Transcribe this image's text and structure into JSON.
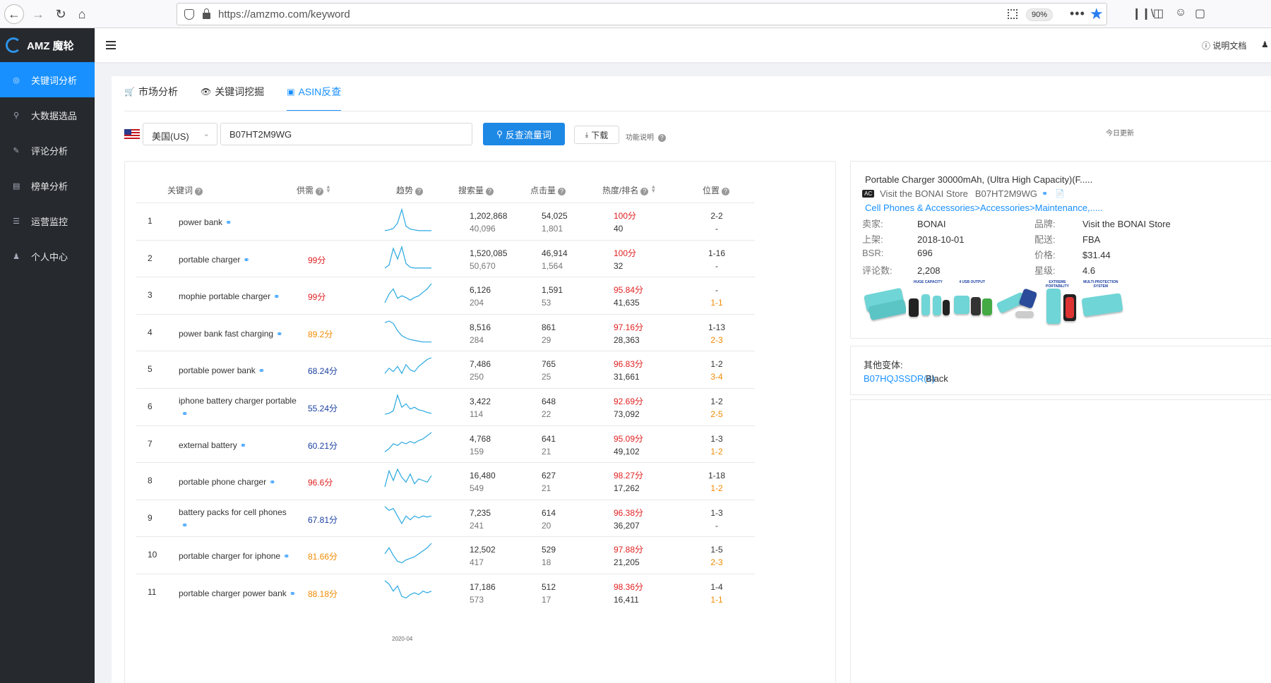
{
  "browser": {
    "url": "https://amzmo.com/keyword",
    "zoom": "90%"
  },
  "app": {
    "title": "AMZ 魔轮"
  },
  "sidebar": {
    "items": [
      {
        "label": "关键词分析",
        "active": true,
        "icon": "target-icon"
      },
      {
        "label": "大数据选品",
        "active": false,
        "icon": "search-icon"
      },
      {
        "label": "评论分析",
        "active": false,
        "icon": "edit-icon"
      },
      {
        "label": "榜单分析",
        "active": false,
        "icon": "list-icon"
      },
      {
        "label": "运营监控",
        "active": false,
        "icon": "menu-icon"
      },
      {
        "label": "个人中心",
        "active": false,
        "icon": "user-icon"
      }
    ]
  },
  "header": {
    "doc": "说明文档"
  },
  "tabs": [
    {
      "label": "市场分析",
      "icon": "cart-icon",
      "active": false
    },
    {
      "label": "关键词挖掘",
      "icon": "eye-icon",
      "active": false
    },
    {
      "label": "ASIN反查",
      "icon": "camera-icon",
      "active": true
    }
  ],
  "search": {
    "country": "美国(US)",
    "asin": "B07HT2M9WG",
    "submit": "反查流量词",
    "download": "下载",
    "func_note": "功能说明",
    "today_note": "今日更新"
  },
  "table": {
    "headers": {
      "keyword": "关键词",
      "supply": "供需",
      "trend": "趋势",
      "search": "搜索量",
      "click": "点击量",
      "heat": "热度/排名",
      "position": "位置"
    },
    "trend_date": "2020-04",
    "rows": [
      {
        "idx": "1",
        "keyword": "power bank",
        "supply": "",
        "supply_color": "",
        "search": "1,202,868",
        "search_sub": "40,096",
        "click": "54,025",
        "click_sub": "1,801",
        "heat": "100分",
        "rank": "40",
        "pos": "2-2",
        "pos_sub": "-",
        "pos_sub_color": "",
        "trend": [
          2,
          3,
          5,
          12,
          30,
          8,
          4,
          3,
          2,
          2,
          2,
          2
        ]
      },
      {
        "idx": "2",
        "keyword": "portable charger",
        "supply": "99分",
        "supply_color": "red",
        "search": "1,520,085",
        "search_sub": "50,670",
        "click": "46,914",
        "click_sub": "1,564",
        "heat": "100分",
        "rank": "32",
        "pos": "1-16",
        "pos_sub": "-",
        "pos_sub_color": "",
        "trend": [
          2,
          6,
          28,
          14,
          30,
          8,
          3,
          2,
          2,
          2,
          2,
          2
        ]
      },
      {
        "idx": "3",
        "keyword": "mophie portable charger",
        "supply": "99分",
        "supply_color": "red",
        "search": "6,126",
        "search_sub": "204",
        "click": "1,591",
        "click_sub": "53",
        "heat": "95.84分",
        "rank": "41,635",
        "pos": "-",
        "pos_sub": "1-1",
        "pos_sub_color": "orange",
        "trend": [
          4,
          14,
          20,
          9,
          12,
          10,
          7,
          10,
          12,
          16,
          20,
          26
        ]
      },
      {
        "idx": "4",
        "keyword": "power bank fast charging",
        "supply": "89.2分",
        "supply_color": "orange",
        "search": "8,516",
        "search_sub": "284",
        "click": "861",
        "click_sub": "29",
        "heat": "97.16分",
        "rank": "28,363",
        "pos": "1-13",
        "pos_sub": "2-3",
        "pos_sub_color": "orange",
        "trend": [
          26,
          28,
          25,
          16,
          10,
          7,
          5,
          4,
          3,
          2,
          2,
          2
        ]
      },
      {
        "idx": "5",
        "keyword": "portable power bank",
        "supply": "68.24分",
        "supply_color": "blue",
        "search": "7,486",
        "search_sub": "250",
        "click": "765",
        "click_sub": "25",
        "heat": "96.83分",
        "rank": "31,661",
        "pos": "1-2",
        "pos_sub": "3-4",
        "pos_sub_color": "orange",
        "trend": [
          8,
          14,
          10,
          16,
          8,
          18,
          12,
          10,
          16,
          20,
          24,
          26
        ]
      },
      {
        "idx": "6",
        "keyword": "iphone battery charger portable",
        "supply": "55.24分",
        "supply_color": "blue",
        "search": "3,422",
        "search_sub": "114",
        "click": "648",
        "click_sub": "22",
        "heat": "92.69分",
        "rank": "73,092",
        "pos": "1-2",
        "pos_sub": "2-5",
        "pos_sub_color": "orange",
        "trend": [
          4,
          5,
          8,
          26,
          12,
          16,
          10,
          12,
          9,
          8,
          6,
          5
        ]
      },
      {
        "idx": "7",
        "keyword": "external battery",
        "supply": "60.21分",
        "supply_color": "blue",
        "search": "4,768",
        "search_sub": "159",
        "click": "641",
        "click_sub": "21",
        "heat": "95.09分",
        "rank": "49,102",
        "pos": "1-3",
        "pos_sub": "1-2",
        "pos_sub_color": "orange",
        "trend": [
          4,
          8,
          14,
          12,
          16,
          14,
          17,
          15,
          18,
          20,
          24,
          28
        ]
      },
      {
        "idx": "8",
        "keyword": "portable phone charger",
        "supply": "96.6分",
        "supply_color": "red",
        "search": "16,480",
        "search_sub": "549",
        "click": "627",
        "click_sub": "21",
        "heat": "98.27分",
        "rank": "17,262",
        "pos": "1-18",
        "pos_sub": "1-2",
        "pos_sub_color": "orange",
        "trend": [
          6,
          26,
          14,
          28,
          18,
          12,
          22,
          10,
          16,
          14,
          12,
          20
        ]
      },
      {
        "idx": "9",
        "keyword": "battery packs for cell phones",
        "supply": "67.81分",
        "supply_color": "blue",
        "search": "7,235",
        "search_sub": "241",
        "click": "614",
        "click_sub": "20",
        "heat": "96.38分",
        "rank": "36,207",
        "pos": "1-3",
        "pos_sub": "-",
        "pos_sub_color": "",
        "trend": [
          24,
          20,
          22,
          14,
          6,
          14,
          10,
          14,
          12,
          14,
          13,
          14
        ]
      },
      {
        "idx": "10",
        "keyword": "portable charger for iphone",
        "supply": "81.66分",
        "supply_color": "orange",
        "search": "12,502",
        "search_sub": "417",
        "click": "529",
        "click_sub": "18",
        "heat": "97.88分",
        "rank": "21,205",
        "pos": "1-5",
        "pos_sub": "2-3",
        "pos_sub_color": "orange",
        "trend": [
          16,
          24,
          14,
          6,
          4,
          8,
          10,
          12,
          16,
          20,
          24,
          30
        ]
      },
      {
        "idx": "11",
        "keyword": "portable charger power bank",
        "supply": "88.18分",
        "supply_color": "orange",
        "search": "17,186",
        "search_sub": "573",
        "click": "512",
        "click_sub": "17",
        "heat": "98.36分",
        "rank": "16,411",
        "pos": "1-4",
        "pos_sub": "1-1",
        "pos_sub_color": "orange",
        "trend": [
          26,
          22,
          14,
          20,
          8,
          6,
          10,
          12,
          10,
          14,
          12,
          14
        ]
      }
    ]
  },
  "product": {
    "title": "Portable Charger 30000mAh, (Ultra High Capacity)(F.....",
    "badge": "AC",
    "store_line": "Visit the BONAI Store",
    "asin": "B07HT2M9WG",
    "category": "Cell Phones & Accessories>Accessories>Maintenance,.....",
    "seller_label": "卖家:",
    "seller": "BONAI",
    "brand_label": "品牌:",
    "brand": "Visit the BONAI Store",
    "listed_label": "上架:",
    "listed": "2018-10-01",
    "ship_label": "配送:",
    "ship": "FBA",
    "bsr_label": "BSR:",
    "bsr": "696",
    "price_label": "价格:",
    "price": "$31.44",
    "reviews_label": "评论数:",
    "reviews": "2,208",
    "rating_label": "星级:",
    "rating": "4.6",
    "image_captions": [
      "HUGE CAPACITY",
      "4 USB OUTPUT",
      "EXTREME PORTABILITY",
      "MULTI-PROTECTION SYSTEM"
    ]
  },
  "variants": {
    "title": "其他变体:",
    "link": "B07HQJSSDR(4)",
    "color": "Black"
  },
  "colors": {
    "primary": "#1890ff",
    "sidebar": "#26292e",
    "red": "#e02020",
    "orange": "#f08a00",
    "blue_dark": "#1a3fa0",
    "trend_line": "#29a8e0"
  }
}
